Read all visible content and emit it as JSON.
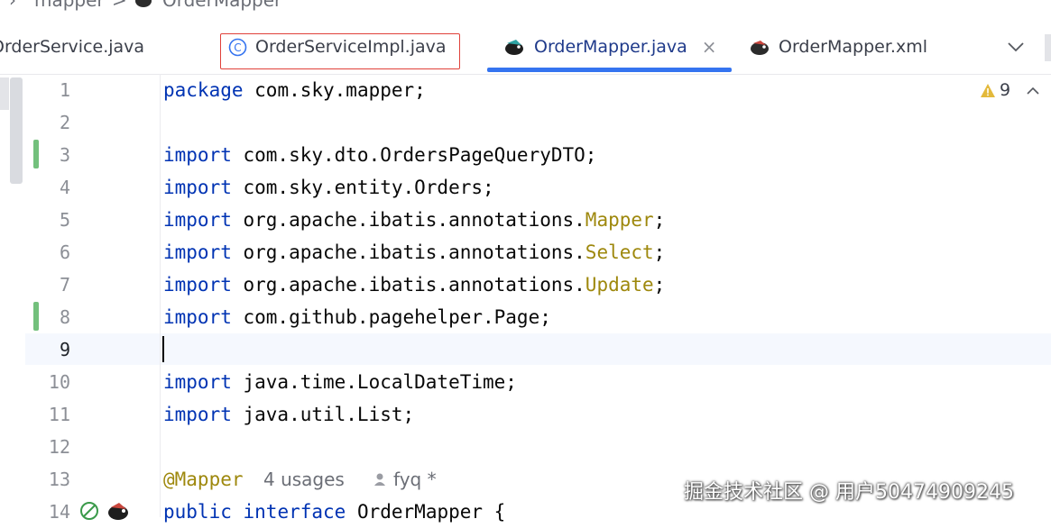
{
  "breadcrumb": {
    "folder": "mapper",
    "sep": ">",
    "file": "OrderMapper"
  },
  "tabs": [
    {
      "label": "OrderService.java",
      "icon": "interface-icon"
    },
    {
      "label": "OrderServiceImpl.java",
      "icon": "class-icon"
    },
    {
      "label": "OrderMapper.java",
      "icon": "mybatis-icon",
      "close": "×"
    },
    {
      "label": "OrderMapper.xml",
      "icon": "mybatis-icon"
    }
  ],
  "overflow_icon": "chevron-down-icon",
  "inspections": {
    "count": "9",
    "icon": "warning-icon"
  },
  "colors": {
    "keyword": "#0033b3",
    "annotation": "#9e880d",
    "accent": "#3574f0",
    "highlight": "#e0413a"
  },
  "lines": {
    "l1": {
      "num": "1",
      "kw": "package",
      "rest": " com.sky.mapper;"
    },
    "l2": {
      "num": "2"
    },
    "l3": {
      "num": "3",
      "kw": "import",
      "rest": " com.sky.dto.OrdersPageQueryDTO;"
    },
    "l4": {
      "num": "4",
      "kw": "import",
      "rest": " com.sky.entity.Orders;"
    },
    "l5": {
      "num": "5",
      "kw": "import",
      "pre": " org.apache.ibatis.annotations.",
      "ann": "Mapper",
      "end": ";"
    },
    "l6": {
      "num": "6",
      "kw": "import",
      "pre": " org.apache.ibatis.annotations.",
      "ann": "Select",
      "end": ";"
    },
    "l7": {
      "num": "7",
      "kw": "import",
      "pre": " org.apache.ibatis.annotations.",
      "ann": "Update",
      "end": ";"
    },
    "l8": {
      "num": "8",
      "kw": "import",
      "rest": " com.github.pagehelper.Page;"
    },
    "l9": {
      "num": "9"
    },
    "l10": {
      "num": "10",
      "kw": "import",
      "rest": " java.time.LocalDateTime;"
    },
    "l11": {
      "num": "11",
      "kw": "import",
      "rest": " java.util.List;"
    },
    "l12": {
      "num": "12"
    },
    "l13": {
      "num": "13",
      "ann": "@Mapper",
      "usages": "4 usages",
      "author": "fyq *"
    },
    "l14": {
      "num": "14",
      "kw1": "public",
      "kw2": "interface",
      "rest": " OrderMapper {"
    }
  },
  "watermark": "掘金技术社区 @ 用户50474909245"
}
